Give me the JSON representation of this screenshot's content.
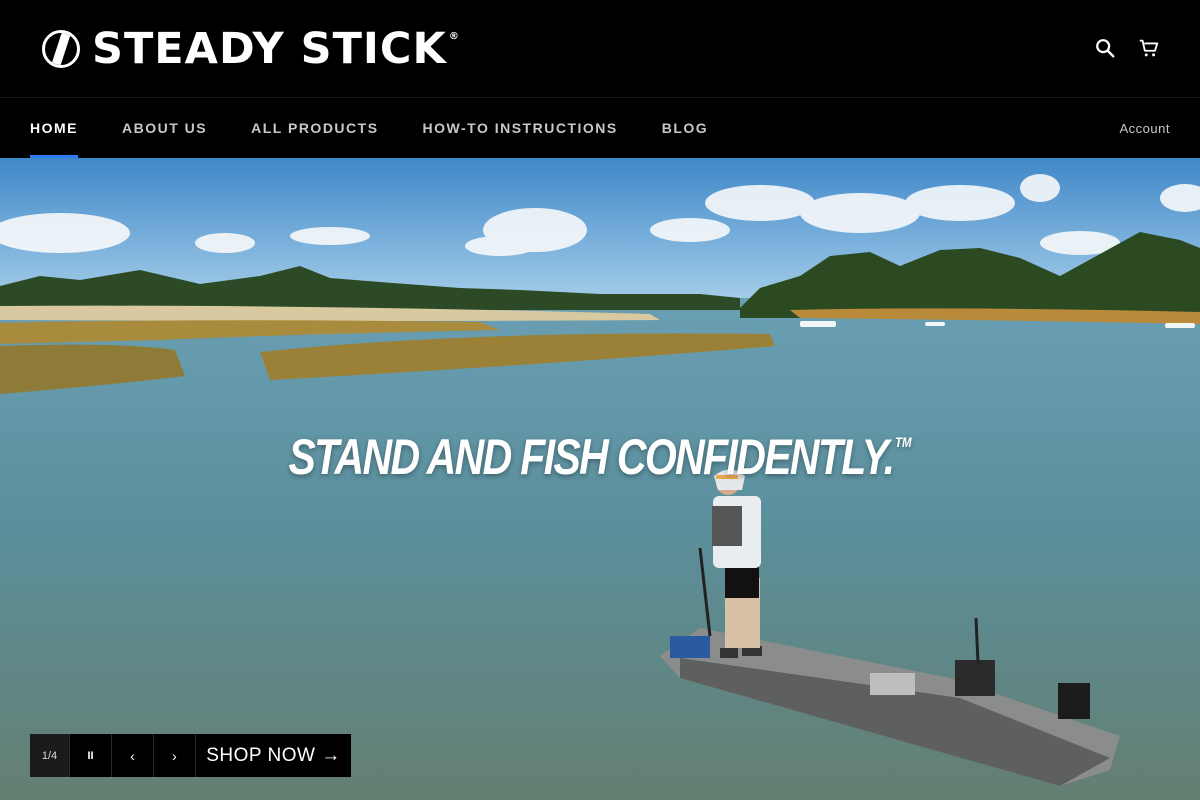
{
  "brand": {
    "name": "STEADY STICK",
    "reg": "®"
  },
  "header": {
    "icons": [
      "search-icon",
      "cart-icon"
    ]
  },
  "nav": {
    "items": [
      {
        "label": "HOME",
        "active": true
      },
      {
        "label": "ABOUT US"
      },
      {
        "label": "ALL PRODUCTS"
      },
      {
        "label": "HOW-TO INSTRUCTIONS"
      },
      {
        "label": "BLOG"
      }
    ],
    "account": "Account",
    "accent": "#2c7ef4"
  },
  "hero": {
    "headline": "STAND AND FISH CONFIDENTLY.",
    "tm": "TM",
    "slide_counter": "1/4",
    "pause_symbol": "II",
    "prev_symbol": "‹",
    "next_symbol": "›",
    "cta": "SHOP NOW →"
  }
}
